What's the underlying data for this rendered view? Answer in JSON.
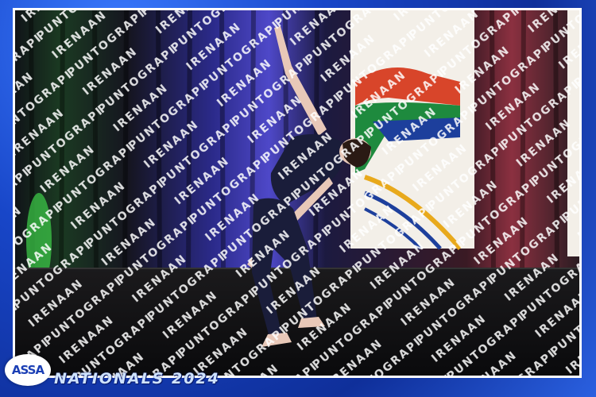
{
  "watermark": {
    "text": "IRENAAN PUNTOGRAPHY"
  },
  "banner": {
    "text": "NATIONALS"
  },
  "logo": {
    "text": "ASSA"
  },
  "event": {
    "title": "NATIONALS 2024"
  },
  "colors": {
    "frame_blue": "#1846c8",
    "title_text": "#cfe3ff"
  }
}
